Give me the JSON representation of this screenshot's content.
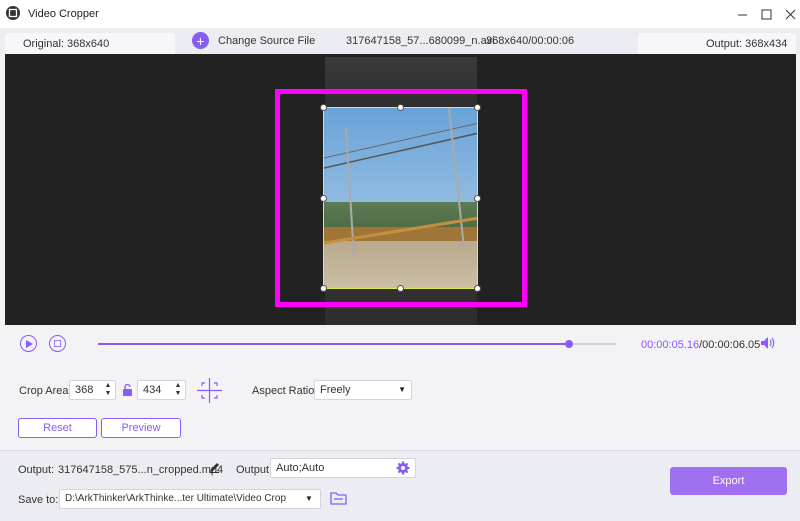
{
  "window": {
    "title": "Video Cropper",
    "minimize_icon": "minimize-icon",
    "maximize_icon": "maximize-icon",
    "close_icon": "close-icon"
  },
  "infobar": {
    "original_label": "Original: 368x640",
    "change_source_label": "Change Source File",
    "file_name": "317647158_57...680099_n.avi",
    "file_meta": "368x640/00:00:06",
    "output_label": "Output: 368x434"
  },
  "playback": {
    "current_time": "00:00:05.16",
    "total_time": "/00:00:06.05",
    "progress": 0.91
  },
  "crop": {
    "crop_area_label": "Crop Area:",
    "width": "368",
    "height": "434",
    "aspect_label": "Aspect Ratio:",
    "aspect_value": "Freely",
    "reset_label": "Reset",
    "preview_label": "Preview"
  },
  "output": {
    "output_label": "Output:",
    "output_file": "317647158_575...n_cropped.mp4",
    "output_settings_label": "Output:",
    "output_settings_value": "Auto;Auto",
    "save_to_label": "Save to:",
    "save_path": "D:\\ArkThinker\\ArkThinke...ter Ultimate\\Video Crop",
    "export_label": "Export"
  },
  "colors": {
    "accent": "#8a5cf6",
    "highlight_box": "#ff00ff",
    "crop_border": "#e6ec4a"
  }
}
